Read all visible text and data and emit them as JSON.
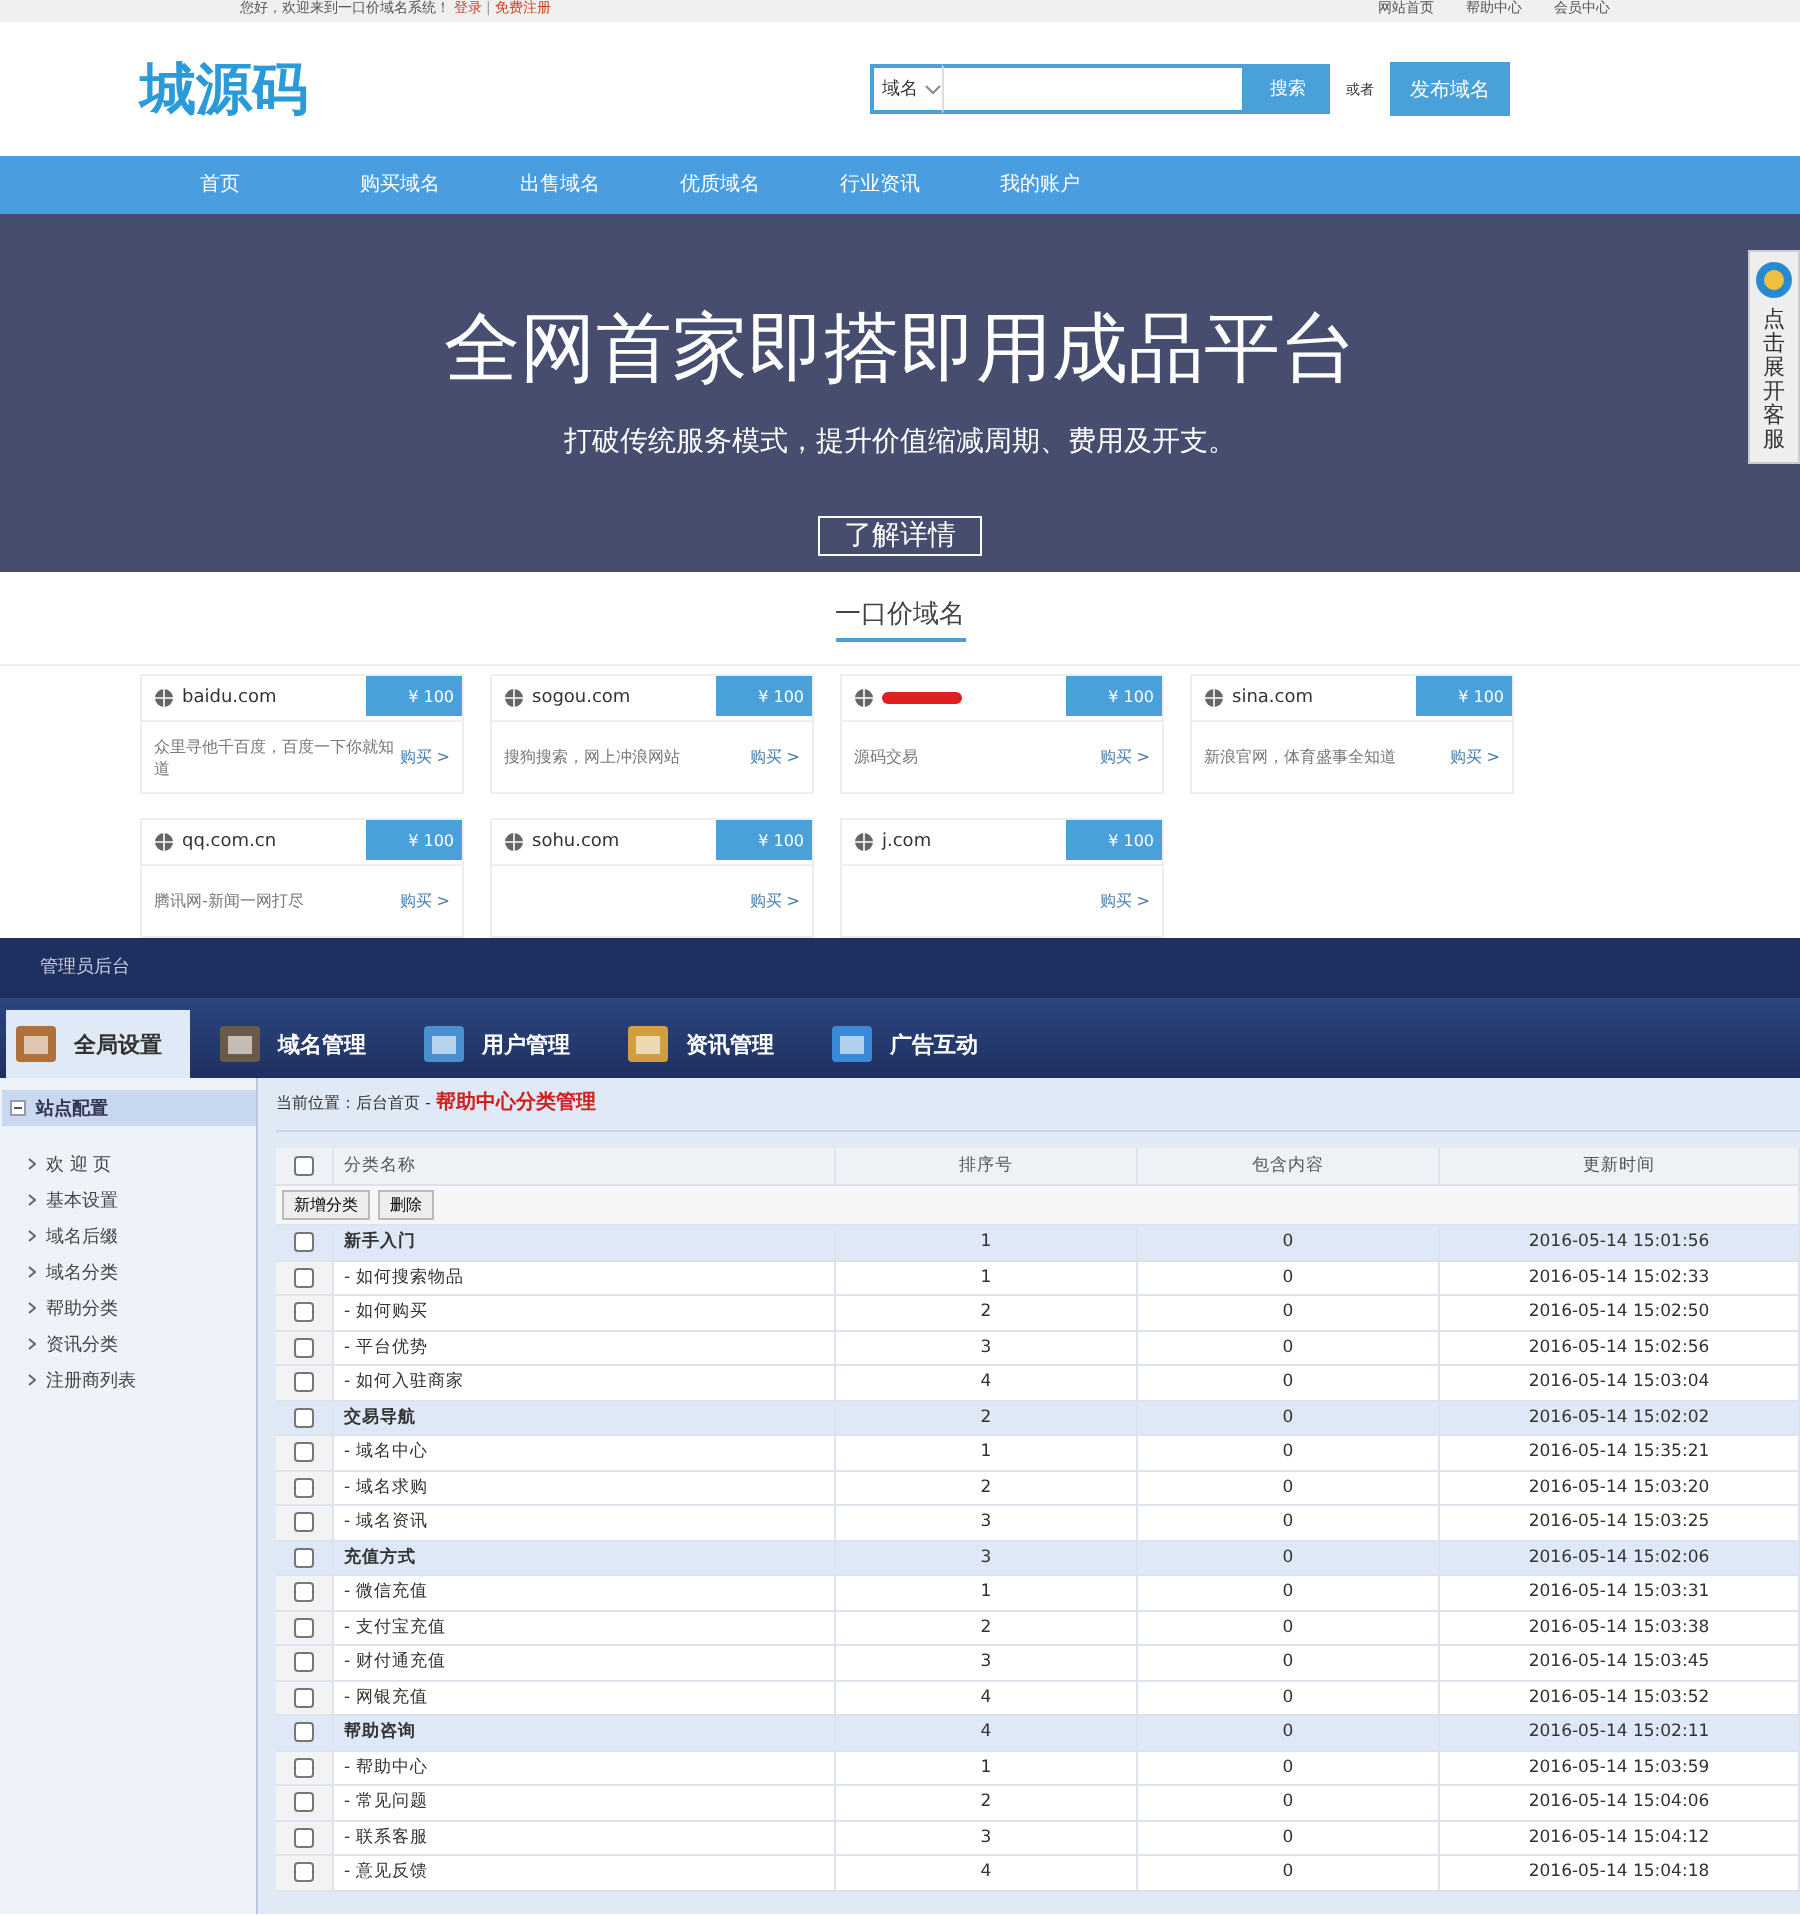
{
  "top_bar": {
    "greeting": "您好，欢迎来到一口价域名系统！",
    "login": "登录",
    "separator": "|",
    "register": "免费注册",
    "links": [
      "网站首页",
      "帮助中心",
      "会员中心"
    ]
  },
  "header": {
    "logo": "城源码",
    "search": {
      "scope": "域名",
      "button": "搜索"
    },
    "or": "或者",
    "publish": "发布域名"
  },
  "nav": [
    "首页",
    "购买域名",
    "出售域名",
    "优质域名",
    "行业资讯",
    "我的账户"
  ],
  "banner": {
    "title": "全网首家即搭即用成品平台",
    "subtitle": "打破传统服务模式，提升价值缩减周期、费用及开支。",
    "button": "了解详情"
  },
  "service_tab": "点击展开客服",
  "section_title": "一口价域名",
  "domains": [
    {
      "name": "baidu.com",
      "price": "¥ 100",
      "desc": "众里寻他千百度，百度一下你就知道",
      "buy": "购买 >",
      "redacted": false
    },
    {
      "name": "sogou.com",
      "price": "¥ 100",
      "desc": "搜狗搜索，网上冲浪网站",
      "buy": "购买 >",
      "redacted": false
    },
    {
      "price": "¥ 100",
      "desc": "源码交易",
      "buy": "购买 >",
      "redacted": true
    },
    {
      "name": "sina.com",
      "price": "¥ 100",
      "desc": "新浪官网，体育盛事全知道",
      "buy": "购买 >",
      "redacted": false
    },
    {
      "name": "qq.com.cn",
      "price": "¥ 100",
      "desc": "腾讯网-新闻一网打尽",
      "buy": "购买 >",
      "redacted": false
    },
    {
      "name": "sohu.com",
      "price": "¥ 100",
      "buy": "购买 >",
      "redacted": false
    },
    {
      "name": "j.com",
      "price": "¥ 100",
      "buy": "购买 >",
      "redacted": false
    }
  ],
  "admin": {
    "title": "管理员后台",
    "tabs": [
      {
        "label": "全局设置",
        "selected": true,
        "kind": "box"
      },
      {
        "label": "域名管理",
        "selected": false,
        "kind": "grid"
      },
      {
        "label": "用户管理",
        "selected": false,
        "kind": "card"
      },
      {
        "label": "资讯管理",
        "selected": false,
        "kind": "folder"
      },
      {
        "label": "广告互动",
        "selected": false,
        "kind": "list"
      }
    ],
    "sidebar": {
      "title": "站点配置",
      "items": [
        "欢 迎 页",
        "基本设置",
        "域名后缀",
        "域名分类",
        "帮助分类",
        "资讯分类",
        "注册商列表"
      ]
    },
    "breadcrumb": {
      "prefix": "当前位置：后台首页 - ",
      "current": "帮助中心分类管理"
    },
    "table": {
      "select_all_checked": false,
      "columns": [
        "分类名称",
        "排序号",
        "包含内容",
        "更新时间"
      ],
      "buttons": [
        "新增分类",
        "删除"
      ],
      "rows": [
        {
          "name": "新手入门",
          "kind": "group",
          "order": "1",
          "count": "0",
          "time": "2016-05-14 15:01:56",
          "checked": false
        },
        {
          "name": "- 如何搜索物品",
          "kind": "item",
          "order": "1",
          "count": "0",
          "time": "2016-05-14 15:02:33",
          "checked": false
        },
        {
          "name": "- 如何购买",
          "kind": "item",
          "order": "2",
          "count": "0",
          "time": "2016-05-14 15:02:50",
          "checked": false
        },
        {
          "name": "- 平台优势",
          "kind": "item",
          "order": "3",
          "count": "0",
          "time": "2016-05-14 15:02:56",
          "checked": false
        },
        {
          "name": "- 如何入驻商家",
          "kind": "item",
          "order": "4",
          "count": "0",
          "time": "2016-05-14 15:03:04",
          "checked": false
        },
        {
          "name": "交易导航",
          "kind": "group",
          "order": "2",
          "count": "0",
          "time": "2016-05-14 15:02:02",
          "checked": false
        },
        {
          "name": "- 域名中心",
          "kind": "item",
          "order": "1",
          "count": "0",
          "time": "2016-05-14 15:35:21",
          "checked": false
        },
        {
          "name": "- 域名求购",
          "kind": "item",
          "order": "2",
          "count": "0",
          "time": "2016-05-14 15:03:20",
          "checked": false
        },
        {
          "name": "- 域名资讯",
          "kind": "item",
          "order": "3",
          "count": "0",
          "time": "2016-05-14 15:03:25",
          "checked": false
        },
        {
          "name": "充值方式",
          "kind": "group",
          "order": "3",
          "count": "0",
          "time": "2016-05-14 15:02:06",
          "checked": false
        },
        {
          "name": "- 微信充值",
          "kind": "item",
          "order": "1",
          "count": "0",
          "time": "2016-05-14 15:03:31",
          "checked": false
        },
        {
          "name": "- 支付宝充值",
          "kind": "item",
          "order": "2",
          "count": "0",
          "time": "2016-05-14 15:03:38",
          "checked": false
        },
        {
          "name": "- 财付通充值",
          "kind": "item",
          "order": "3",
          "count": "0",
          "time": "2016-05-14 15:03:45",
          "checked": false
        },
        {
          "name": "- 网银充值",
          "kind": "item",
          "order": "4",
          "count": "0",
          "time": "2016-05-14 15:03:52",
          "checked": false
        },
        {
          "name": "帮助咨询",
          "kind": "group",
          "order": "4",
          "count": "0",
          "time": "2016-05-14 15:02:11",
          "checked": false
        },
        {
          "name": "- 帮助中心",
          "kind": "item",
          "order": "1",
          "count": "0",
          "time": "2016-05-14 15:03:59",
          "checked": false
        },
        {
          "name": "- 常见问题",
          "kind": "item",
          "order": "2",
          "count": "0",
          "time": "2016-05-14 15:04:06",
          "checked": false
        },
        {
          "name": "- 联系客服",
          "kind": "item",
          "order": "3",
          "count": "0",
          "time": "2016-05-14 15:04:12",
          "checked": false
        },
        {
          "name": "- 意见反馈",
          "kind": "item",
          "order": "4",
          "count": "0",
          "time": "2016-05-14 15:04:18",
          "checked": false
        }
      ]
    }
  }
}
